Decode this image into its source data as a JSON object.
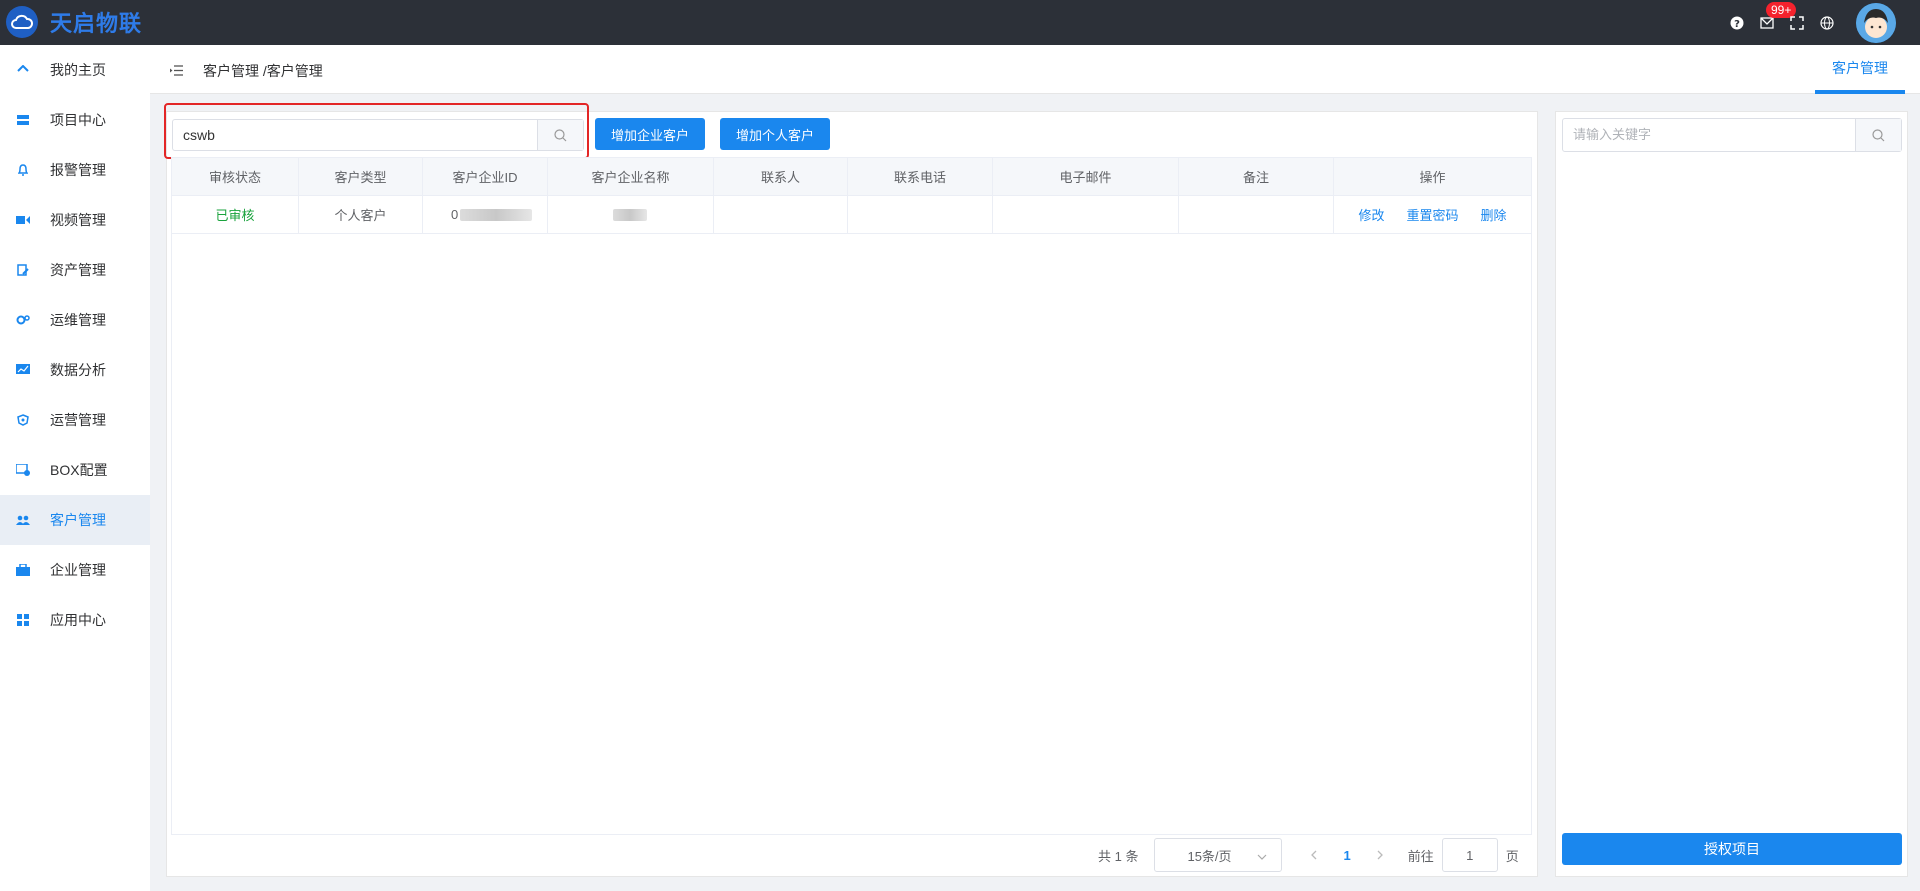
{
  "app": {
    "logo_text": "天启物联"
  },
  "topbar": {
    "badge": "99+",
    "icons": [
      "help-icon",
      "mail-icon",
      "fullscreen-icon",
      "globe-icon"
    ]
  },
  "sidebar": {
    "items": [
      {
        "label": "我的主页",
        "icon": "home-icon"
      },
      {
        "label": "项目中心",
        "icon": "project-icon"
      },
      {
        "label": "报警管理",
        "icon": "bell-icon"
      },
      {
        "label": "视频管理",
        "icon": "video-icon"
      },
      {
        "label": "资产管理",
        "icon": "asset-icon"
      },
      {
        "label": "运维管理",
        "icon": "gears-icon"
      },
      {
        "label": "数据分析",
        "icon": "chart-icon"
      },
      {
        "label": "运营管理",
        "icon": "operation-icon"
      },
      {
        "label": "BOX配置",
        "icon": "box-icon"
      },
      {
        "label": "客户管理",
        "icon": "users-icon",
        "active": true
      },
      {
        "label": "企业管理",
        "icon": "briefcase-icon"
      },
      {
        "label": "应用中心",
        "icon": "apps-icon"
      }
    ]
  },
  "header": {
    "breadcrumb": "客户管理 /客户管理",
    "tab": "客户管理"
  },
  "main": {
    "search_value": "cswb",
    "add_company_label": "增加企业客户",
    "add_person_label": "增加个人客户",
    "table": {
      "columns": [
        "审核状态",
        "客户类型",
        "客户企业ID",
        "客户企业名称",
        "联系人",
        "联系电话",
        "电子邮件",
        "备注",
        "操作"
      ],
      "rows": [
        {
          "status": "已审核",
          "type": "个人客户",
          "company_id": "0",
          "company_name": "",
          "contact": "",
          "phone": "",
          "email": "",
          "remark": ""
        }
      ],
      "actions": [
        "修改",
        "重置密码",
        "删除"
      ]
    },
    "pager": {
      "total": "共 1 条",
      "page_size": "15条/页",
      "current_page": "1",
      "goto_label": "前往",
      "goto_value": "1",
      "page_suffix": "页"
    }
  },
  "right_panel": {
    "search_placeholder": "请输入关键字",
    "authorize_label": "授权项目"
  },
  "colors": {
    "primary": "#1a87ee",
    "topbar": "#2c3038",
    "success": "#1aa33d",
    "highlight": "#e32626"
  }
}
